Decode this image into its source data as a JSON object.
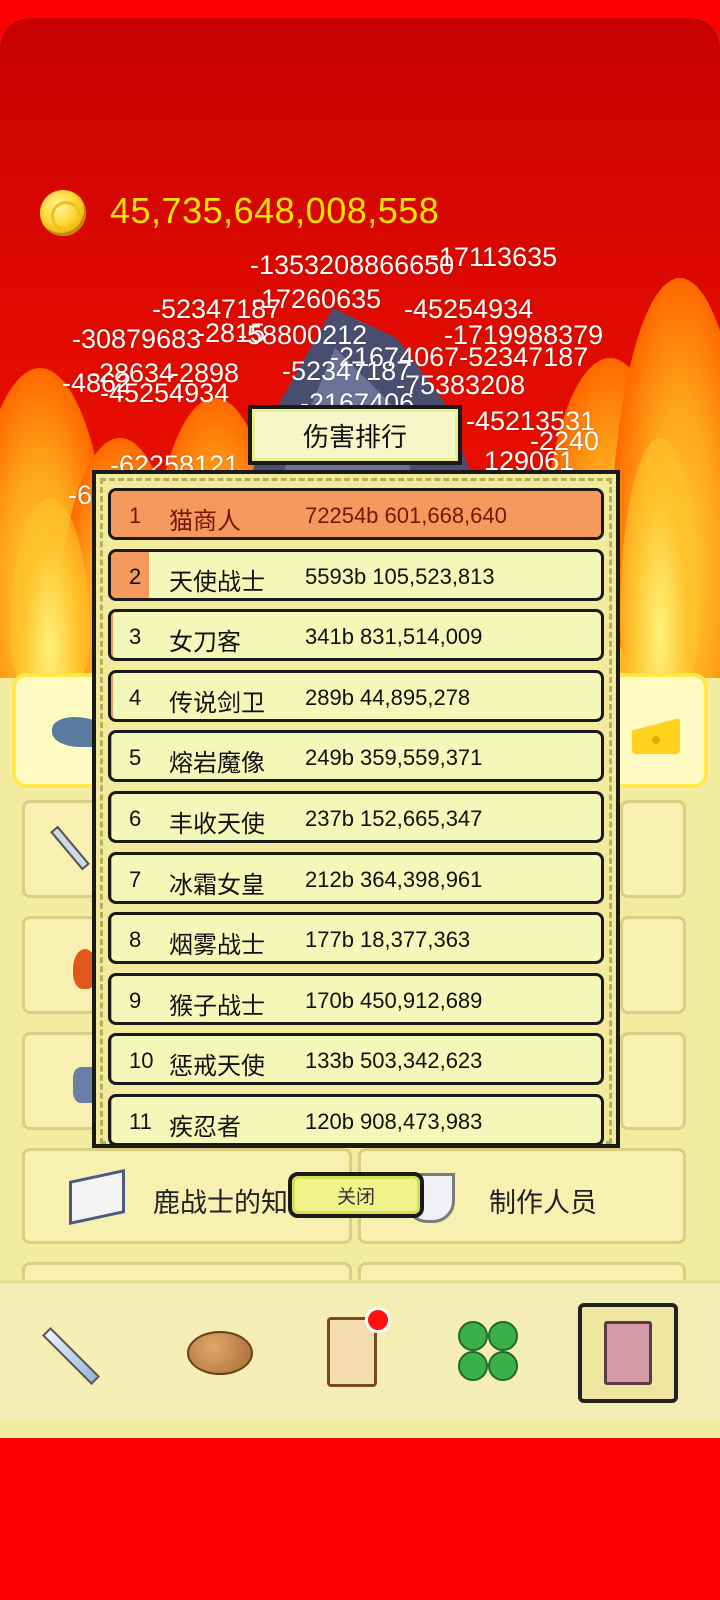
{
  "hud": {
    "coin_icon": "gold-coin-icon",
    "coins": "45,735,648,008,558"
  },
  "damage_popups": [
    "-1353208866650",
    "-17113635",
    "-52347187",
    "-17260635",
    "-45254934",
    "-30879683",
    "-2815",
    "-58800212",
    "-1719988379",
    "-21674067-52347187",
    "-28634",
    "-2898",
    "-45254934",
    "-52347187",
    "-75383208",
    "-2167406",
    "-4862",
    "-62258121",
    "-45213531",
    "-2240",
    "129061",
    "-6"
  ],
  "modal": {
    "title": "伤害排行",
    "close_label": "关闭",
    "rows": [
      {
        "rank": "1",
        "name": "猫商人",
        "damage": "72254b 601,668,640",
        "share": 1.0
      },
      {
        "rank": "2",
        "name": "天使战士",
        "damage": "5593b 105,523,813",
        "share": 0.077
      },
      {
        "rank": "3",
        "name": "女刀客",
        "damage": "341b 831,514,009",
        "share": 0.005
      },
      {
        "rank": "4",
        "name": "传说剑卫",
        "damage": "289b 44,895,278",
        "share": 0.004
      },
      {
        "rank": "5",
        "name": "熔岩魔像",
        "damage": "249b 359,559,371",
        "share": 0.003
      },
      {
        "rank": "6",
        "name": "丰收天使",
        "damage": "237b 152,665,347",
        "share": 0.003
      },
      {
        "rank": "7",
        "name": "冰霜女皇",
        "damage": "212b 364,398,961",
        "share": 0.003
      },
      {
        "rank": "8",
        "name": "烟雾战士",
        "damage": "177b 18,377,363",
        "share": 0.002
      },
      {
        "rank": "9",
        "name": "猴子战士",
        "damage": "170b 450,912,689",
        "share": 0.002
      },
      {
        "rank": "10",
        "name": "惩戒天使",
        "damage": "133b 503,342,623",
        "share": 0.002
      },
      {
        "rank": "11",
        "name": "疾忍者",
        "damage": "120b 908,473,983",
        "share": 0.002
      }
    ]
  },
  "panel": {
    "tile_knowledge": "鹿战士的知识",
    "tile_credits": "制作人员"
  },
  "nav": {
    "items": [
      "sword-icon",
      "bread-icon",
      "scroll-icon",
      "clover-icon",
      "book-icon"
    ],
    "active": "book-icon",
    "notification_color": "#ff1010"
  },
  "colors": {
    "rank1_fill": "#f59a5e",
    "coin_text": "#ffe400",
    "row_bg": "#f3f7b8"
  }
}
